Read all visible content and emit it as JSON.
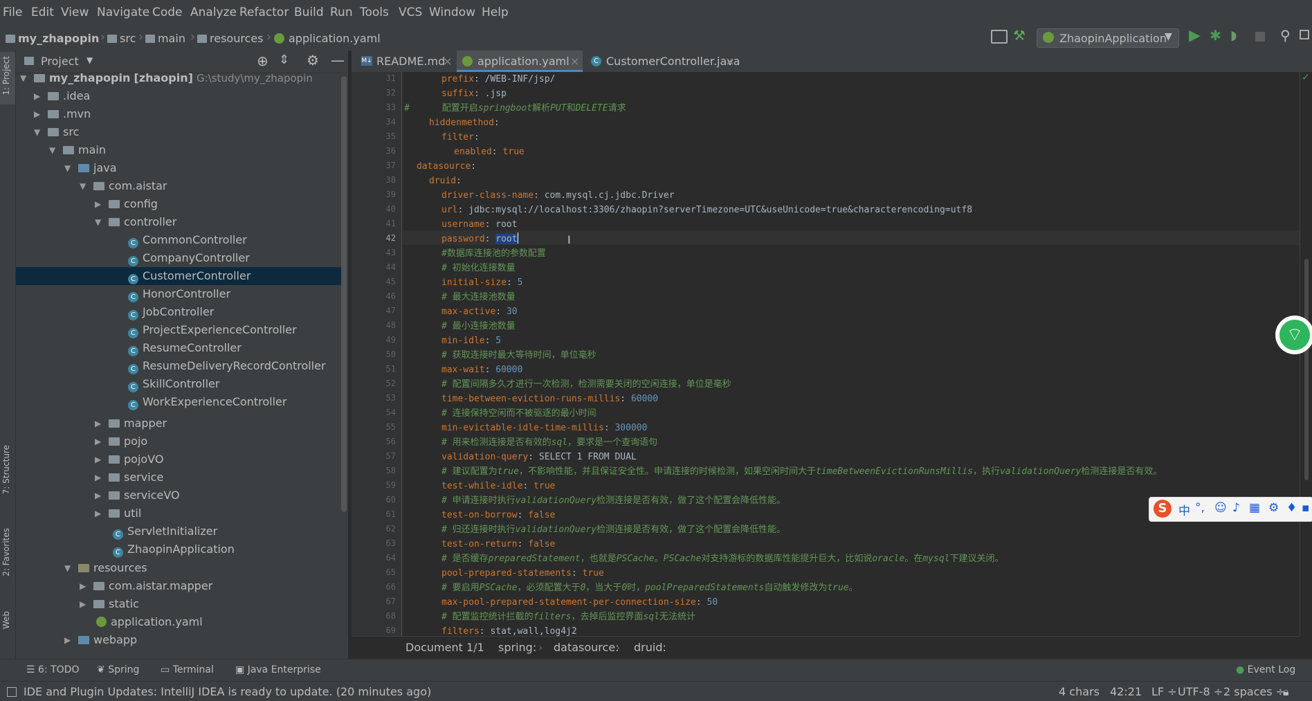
{
  "menu": [
    "File",
    "Edit",
    "View",
    "Navigate",
    "Code",
    "Analyze",
    "Refactor",
    "Build",
    "Run",
    "Tools",
    "VCS",
    "Window",
    "Help"
  ],
  "breadcrumbs": [
    "my_zhapopin",
    "src",
    "main",
    "resources",
    "application.yaml"
  ],
  "run_config": "ZhaopinApplication",
  "left_strip": {
    "project": "1: Project",
    "structure": "7: Structure",
    "favorites": "2: Favorites",
    "web": "Web"
  },
  "project_panel": {
    "title": "Project",
    "tree": [
      {
        "label": "my_zhapopin",
        "extra": "[zhaopin]",
        "path": "G:\\study\\my_zhapopin"
      },
      {
        "label": ".idea"
      },
      {
        "label": ".mvn"
      },
      {
        "label": "src"
      },
      {
        "label": "main"
      },
      {
        "label": "java"
      },
      {
        "label": "com.aistar"
      },
      {
        "label": "config"
      },
      {
        "label": "controller"
      },
      {
        "label": "CommonController"
      },
      {
        "label": "CompanyController"
      },
      {
        "label": "CustomerController"
      },
      {
        "label": "HonorController"
      },
      {
        "label": "JobController"
      },
      {
        "label": "ProjectExperienceController"
      },
      {
        "label": "ResumeController"
      },
      {
        "label": "ResumeDeliveryRecordController"
      },
      {
        "label": "SkillController"
      },
      {
        "label": "WorkExperienceController"
      },
      {
        "label": "mapper"
      },
      {
        "label": "pojo"
      },
      {
        "label": "pojoVO"
      },
      {
        "label": "service"
      },
      {
        "label": "serviceVO"
      },
      {
        "label": "util"
      },
      {
        "label": "ServletInitializer"
      },
      {
        "label": "ZhaopinApplication"
      },
      {
        "label": "resources"
      },
      {
        "label": "com.aistar.mapper"
      },
      {
        "label": "static"
      },
      {
        "label": "application.yaml"
      },
      {
        "label": "webapp"
      }
    ]
  },
  "tabs": [
    "README.md",
    "application.yaml",
    "CustomerController.java"
  ],
  "line_numbers": [
    "31",
    "32",
    "33",
    "34",
    "35",
    "36",
    "37",
    "38",
    "39",
    "40",
    "41",
    "42",
    "43",
    "44",
    "45",
    "46",
    "47",
    "48",
    "49",
    "50",
    "51",
    "52",
    "53",
    "54",
    "55",
    "56",
    "57",
    "58",
    "59",
    "60",
    "61",
    "62",
    "63",
    "64",
    "65",
    "66",
    "67",
    "68",
    "69"
  ],
  "code": {
    "l31k": "prefix",
    "l31v": " /WEB-INF/jsp/",
    "l32k": "suffix",
    "l32v": " .jsp",
    "l33a": "#      配置开启",
    "l33b": "springboot",
    "l33c": "解析",
    "l33d": "PUT",
    "l33e": "和",
    "l33f": "DELETE",
    "l33g": "请求",
    "l34k": "hiddenmethod",
    "l35k": "filter",
    "l36k": "enabled",
    "l36v": "true",
    "l37k": "datasource",
    "l38k": "druid",
    "l39k": "driver-class-name",
    "l39v": " com.mysql.cj.jdbc.Driver",
    "l40k": "url",
    "l40v": " jdbc:mysql://localhost:3306/zhaopin?serverTimezone=UTC&useUnicode=true&characterencoding=utf8",
    "l41k": "username",
    "l41v": " root",
    "l42k": "password",
    "l42v": "root",
    "l43": "#数据库连接池的参数配置",
    "l44": "# 初始化连接数量",
    "l45k": "initial-size",
    "l45v": "5",
    "l46": "# 最大连接池数量",
    "l47k": "max-active",
    "l47v": "30",
    "l48": "# 最小连接池数量",
    "l49k": "min-idle",
    "l49v": "5",
    "l50": "# 获取连接时最大等待时间，单位毫秒",
    "l51k": "max-wait",
    "l51v": "60000",
    "l52": "# 配置间隔多久才进行一次检测，检测需要关闭的空闲连接，单位是毫秒",
    "l53k": "time-between-eviction-runs-millis",
    "l53v": "60000",
    "l54": "# 连接保持空闲而不被驱逐的最小时间",
    "l55k": "min-evictable-idle-time-millis",
    "l55v": "300000",
    "l56a": "# 用来检测连接是否有效的",
    "l56b": "sql",
    "l56c": "，要求是一个查询语句",
    "l57k": "validation-query",
    "l57v": " SELECT 1 FROM DUAL",
    "l58a": "# 建议配置为",
    "l58b": "true",
    "l58c": "，不影响性能，并且保证安全性。申请连接的时候检测，如果空闲时间大于",
    "l58d": "timeBetweenEvictionRunsMillis",
    "l58e": "，执行",
    "l58f": "validationQuery",
    "l58g": "检测连接是否有效。",
    "l59k": "test-while-idle",
    "l59v": "true",
    "l60a": "# 申请连接时执行",
    "l60b": "validationQuery",
    "l60c": "检测连接是否有效，做了这个配置会降低性能。",
    "l61k": "test-on-borrow",
    "l61v": "false",
    "l62a": "# 归还连接时执行",
    "l62b": "validationQuery",
    "l62c": "检测连接是否有效，做了这个配置会降低性能。",
    "l63k": "test-on-return",
    "l63v": "false",
    "l64a": "# 是否缓存",
    "l64b": "preparedStatement",
    "l64c": "，也就是",
    "l64d": "PSCache",
    "l64e": "。",
    "l64f": "PSCache",
    "l64g": "对支持游标的数据库性能提升巨大，比如说",
    "l64h": "oracle",
    "l64i": "。在",
    "l64j": "mysql",
    "l64k": "下建议关闭。",
    "l65k": "pool-prepared-statements",
    "l65v": "true",
    "l66a": "# 要启用",
    "l66b": "PSCache",
    "l66c": "，必须配置大于",
    "l66d": "0",
    "l66e": "，当大于",
    "l66f": "0",
    "l66g": "时，",
    "l66h": "poolPreparedStatements",
    "l66i": "自动触发修改为",
    "l66j": "true",
    "l66k": "。",
    "l67k": "max-pool-prepared-statement-per-connection-size",
    "l67v": "50",
    "l68a": "# 配置监控统计拦截的",
    "l68b": "filters",
    "l68c": "，去掉后监控界面",
    "l68d": "sql",
    "l68e": "无法统计",
    "l69k": "filters",
    "l69v": " stat,wall,log4j2"
  },
  "editor_breadcrumb": [
    "Document 1/1",
    "spring:",
    "datasource:",
    "druid:"
  ],
  "toolwindows": [
    "6: TODO",
    "Spring",
    "Terminal",
    "Java Enterprise",
    "Event Log"
  ],
  "status": {
    "message": "IDE and Plugin Updates: IntelliJ IDEA is ready to update. (20 minutes ago)",
    "chars": "4 chars",
    "position": "42:21",
    "line_sep": "LF",
    "encoding": "UTF-8",
    "indent": "2 spaces"
  },
  "ime": {
    "logo": "S",
    "mode": "中",
    "punct": "°,"
  }
}
